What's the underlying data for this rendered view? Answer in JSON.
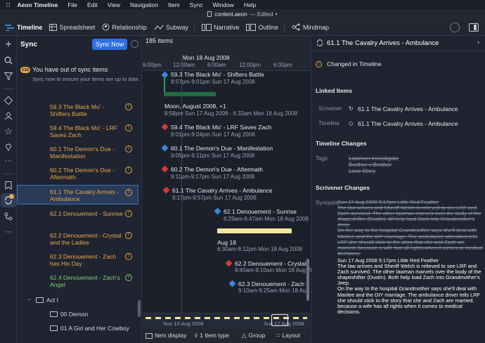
{
  "menubar": {
    "app": "Aeon Timeline",
    "items": [
      "File",
      "Edit",
      "View",
      "Navigation",
      "Item",
      "Sync",
      "Window",
      "Help"
    ]
  },
  "titlebar": {
    "filename": "content.aeon",
    "status": "— Edited"
  },
  "toolbar": {
    "tabs": [
      "Timeline",
      "Spreadsheet",
      "Relationship",
      "Subway",
      "Narrative",
      "Outline",
      "Mindmap"
    ]
  },
  "sync": {
    "title": "Sync",
    "button": "Sync Now",
    "badge": "132",
    "notice": "You have out of sync items",
    "subnotice": "Sync now to ensure your items are up to date.",
    "items": [
      {
        "label": "59.3 The Black Mo' - Shifters Battle",
        "status": "warn"
      },
      {
        "label": "59.4 The Black Mo' - LRF Saves Zach",
        "status": "warn"
      },
      {
        "label": "60.1 The Demon's Due - Manifestation",
        "status": "warn"
      },
      {
        "label": "60.2 The Demon's Due - Aftermath",
        "status": "warn"
      },
      {
        "label": "61.1 The Cavalry Arrives - Ambulance",
        "status": "warn"
      },
      {
        "label": "62.1 Denouement - Sunrise",
        "status": "warn"
      },
      {
        "label": "62.2 Denouement - Crystal and the Ladies",
        "status": "warn"
      },
      {
        "label": "62.3 Denouement - Zach has His Day",
        "status": "warn"
      },
      {
        "label": "62.4 Denouement - Zach's Angel",
        "status": "add"
      }
    ],
    "folders": [
      "Act I",
      "00 Demon",
      "01 A Girl and Her Cowboy"
    ]
  },
  "timeline": {
    "count": "185 items",
    "date_header": "Mon 18 Aug 2008",
    "ticks": [
      "6:00pm",
      "12:00am",
      "6:00am",
      "12:00pm",
      "6:00pm"
    ],
    "events": [
      {
        "title": "59.3 The Black Mo' - Shifters Battle",
        "date": "8:57pm-9:01pm Sun 17 Aug 2008",
        "color": "#3a86d6"
      },
      {
        "title": "Moon, August 2008, +1",
        "date": "8:58pm Sun 17 Aug 2008 - 6:33am Mon 18 Aug 2008",
        "color": ""
      },
      {
        "title": "59.4 The Black Mo' - LRF Saves Zach",
        "date": "9:01pm-9:04pm Sun 17 Aug 2008",
        "color": "#d23a3a"
      },
      {
        "title": "60.1 The Demon's Due - Manifestation",
        "date": "9:05pm-9:11pm Sun 17 Aug 2008",
        "color": "#3a86d6"
      },
      {
        "title": "60.2 The Demon's Due - Aftermath",
        "date": "9:11pm-9:17pm Sun 17 Aug 2008",
        "color": "#d23a3a"
      },
      {
        "title": "61.1 The Cavalry Arrives - Ambulance",
        "date": "9:17pm-9:57pm Sun 17 Aug 2008",
        "color": "#d23a3a"
      },
      {
        "title": "62.1 Denouement - Sunrise",
        "date": "6:29am-6:47am Mon 18 Aug 2008",
        "color": "#3a86d6"
      },
      {
        "title": "Aug 18",
        "date": "6:30am-8:12pm Mon 18 Aug 2008",
        "color": ""
      },
      {
        "title": "62.2 Denouement - Crystal",
        "date": "8:40am-9:10am Mon 18 Aug 2008",
        "color": "#d23a3a"
      },
      {
        "title": "62.3 Denouement - Zach h",
        "date": "9:10am-9:25am Mon 18 Aug 2008",
        "color": "#3a86d6"
      }
    ],
    "minimap_left": "Sun 10 Aug 2008",
    "minimap_right": "Sun 17 Aug 2008",
    "bottom": [
      "Item display",
      "1 Item type",
      "Group",
      "Layout"
    ]
  },
  "inspector": {
    "title": "61.1 The Cavalry Arrives - Ambulance",
    "changed": "Changed in Timeline",
    "linked_h": "Linked Items",
    "linked": [
      {
        "app": "Scrivener",
        "label": "61.1 The Cavalry Arrives - Ambulance"
      },
      {
        "app": "Timeline",
        "label": "61.1 The Cavalry Arrives - Ambulance"
      }
    ],
    "tl_changes_h": "Timeline Changes",
    "tags_label": "Tags",
    "tags": [
      "Lawmen Investigate",
      "Brother v Brother",
      "Love Story"
    ],
    "scriv_h": "Scrivener Changes",
    "synopsis_label": "Synopsis",
    "old_text": "Sun 17 Aug 2008 9:17pm Little Red Feather\nThe law arrives and Sheriff Welch is relieved to see LRF and Zach survived. The other lawman marvels over the body of the shapeshifter (Dustin). All help load Zach into Grandmother's Jeep.\nOn the way to the hospital Grandmother says she'll deal with Marilee and the DIY marriage. The ambulance attendant tells LRF she should stick to the story that she and Zach are married, because a wife has all rights when it comes to medical decisions.",
    "new_text": "Sun 17 Aug 2008 9:17pm Little Red Feather\nThe law arrives and Sheriff Welch is relieved to see LRF and Zach survived. The other lawman marvels over the body of the shapeshifter (Dustin). Both help load Zach into Grandmother's Jeep.\nOn the way to the hospital Grandmother says she'll deal with Marilee and the DIY marriage. The ambulance driver tells LRF she should stick to the story that she and Zach are married, because a wife has all rights when it comes to medical decisions."
  }
}
